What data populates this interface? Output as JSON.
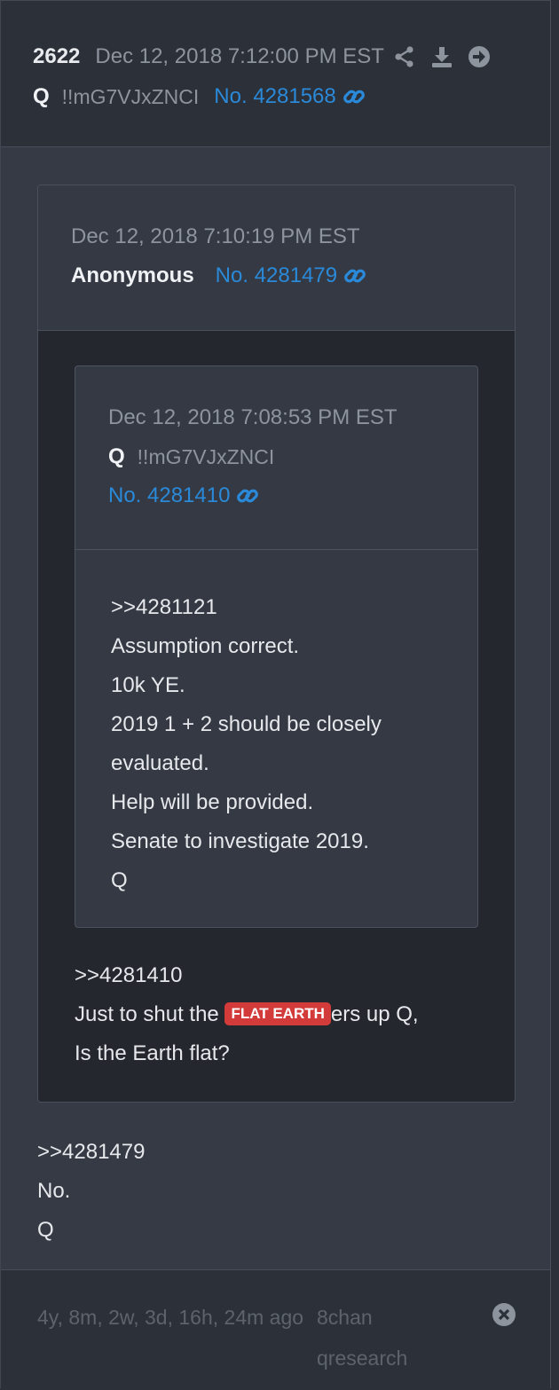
{
  "header": {
    "post_number": "2622",
    "date": "Dec 12, 2018 7:12:00 PM EST",
    "author": "Q",
    "tripcode": "!!mG7VJxZNCI",
    "post_no": "No. 4281568"
  },
  "quoted_post": {
    "date": "Dec 12, 2018 7:10:19 PM EST",
    "author": "Anonymous",
    "post_no": "No. 4281479",
    "body_line1": ">>4281410",
    "body_line2_before": "Just to shut the ",
    "tag": "FLAT EARTH",
    "body_line2_after": "ers up Q,",
    "body_line3": "Is the Earth flat?",
    "nested_post": {
      "date": "Dec 12, 2018 7:08:53 PM EST",
      "author": "Q",
      "tripcode": "!!mG7VJxZNCI",
      "post_no": "No. 4281410",
      "body": [
        ">>4281121",
        "Assumption correct.",
        "10k YE.",
        "2019 1 + 2 should be closely",
        "evaluated.",
        "Help will be provided.",
        "Senate to investigate 2019.",
        "Q"
      ]
    }
  },
  "main_body": [
    ">>4281479",
    "No.",
    "Q"
  ],
  "footer": {
    "time_ago": "4y, 8m, 2w, 3d, 16h, 24m ago",
    "board": "8chan qresearch"
  },
  "colors": {
    "link": "#2a8ad9",
    "tag_bg": "#d23b3a",
    "background": "#353a44"
  },
  "icons": [
    "share-icon",
    "download-icon",
    "arrow-circle-right-icon",
    "link-icon",
    "close-circle-icon"
  ]
}
